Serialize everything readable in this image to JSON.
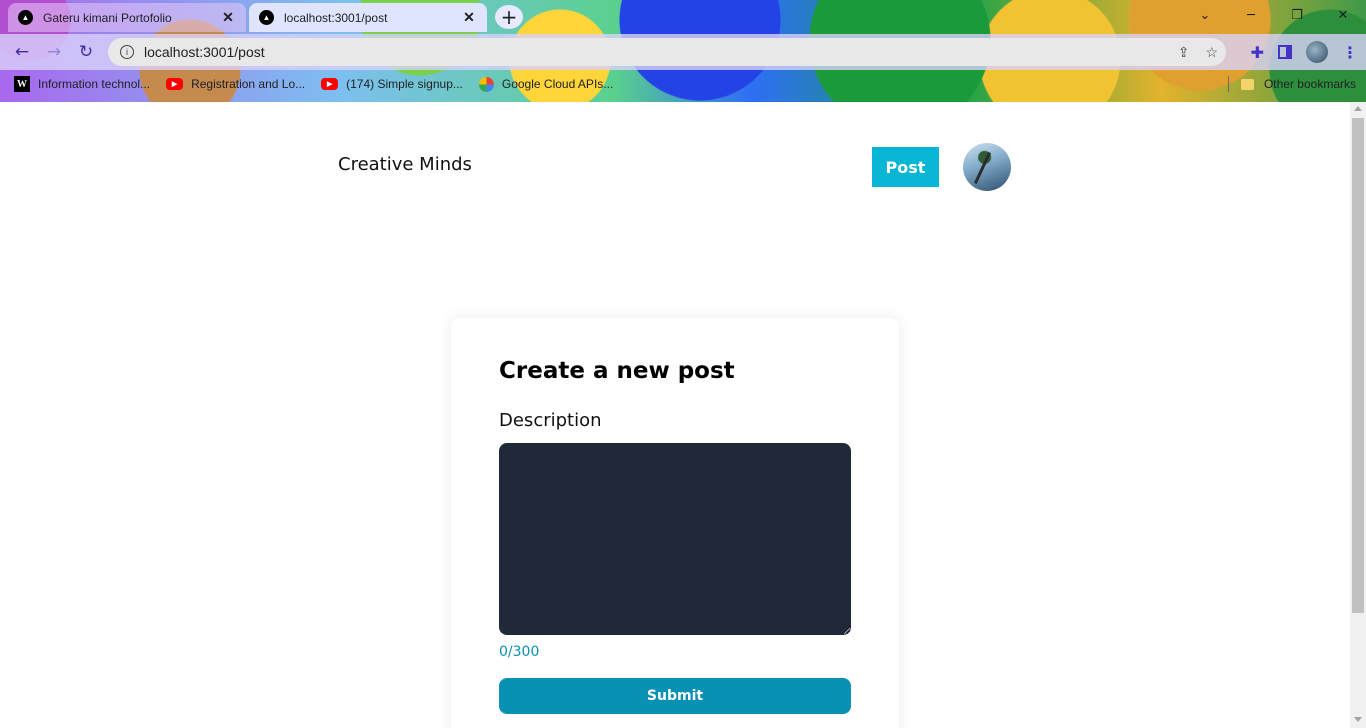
{
  "browser": {
    "tabs": [
      {
        "title": "Gateru kimani Portofolio",
        "active": false
      },
      {
        "title": "localhost:3001/post",
        "active": true
      }
    ],
    "new_tab_symbol": "+",
    "address": "localhost:3001/post",
    "bookmarks": [
      {
        "label": "Information technol...",
        "icon": "wikipedia-icon"
      },
      {
        "label": "Registration and Lo...",
        "icon": "youtube-icon"
      },
      {
        "label": "(174) Simple signup...",
        "icon": "youtube-icon"
      },
      {
        "label": "Google Cloud APIs...",
        "icon": "google-cloud-icon"
      }
    ],
    "other_bookmarks": "Other bookmarks"
  },
  "header": {
    "brand": "Creative Minds",
    "post_button": "Post",
    "post_button_color": "#06b6d4"
  },
  "form": {
    "title": "Create a new post",
    "description_label": "Description",
    "description_value": "",
    "counter": "0/300",
    "counter_color": "#0891b2",
    "submit_label": "Submit",
    "submit_color": "#0891b2",
    "textarea_color": "#1f2937"
  }
}
